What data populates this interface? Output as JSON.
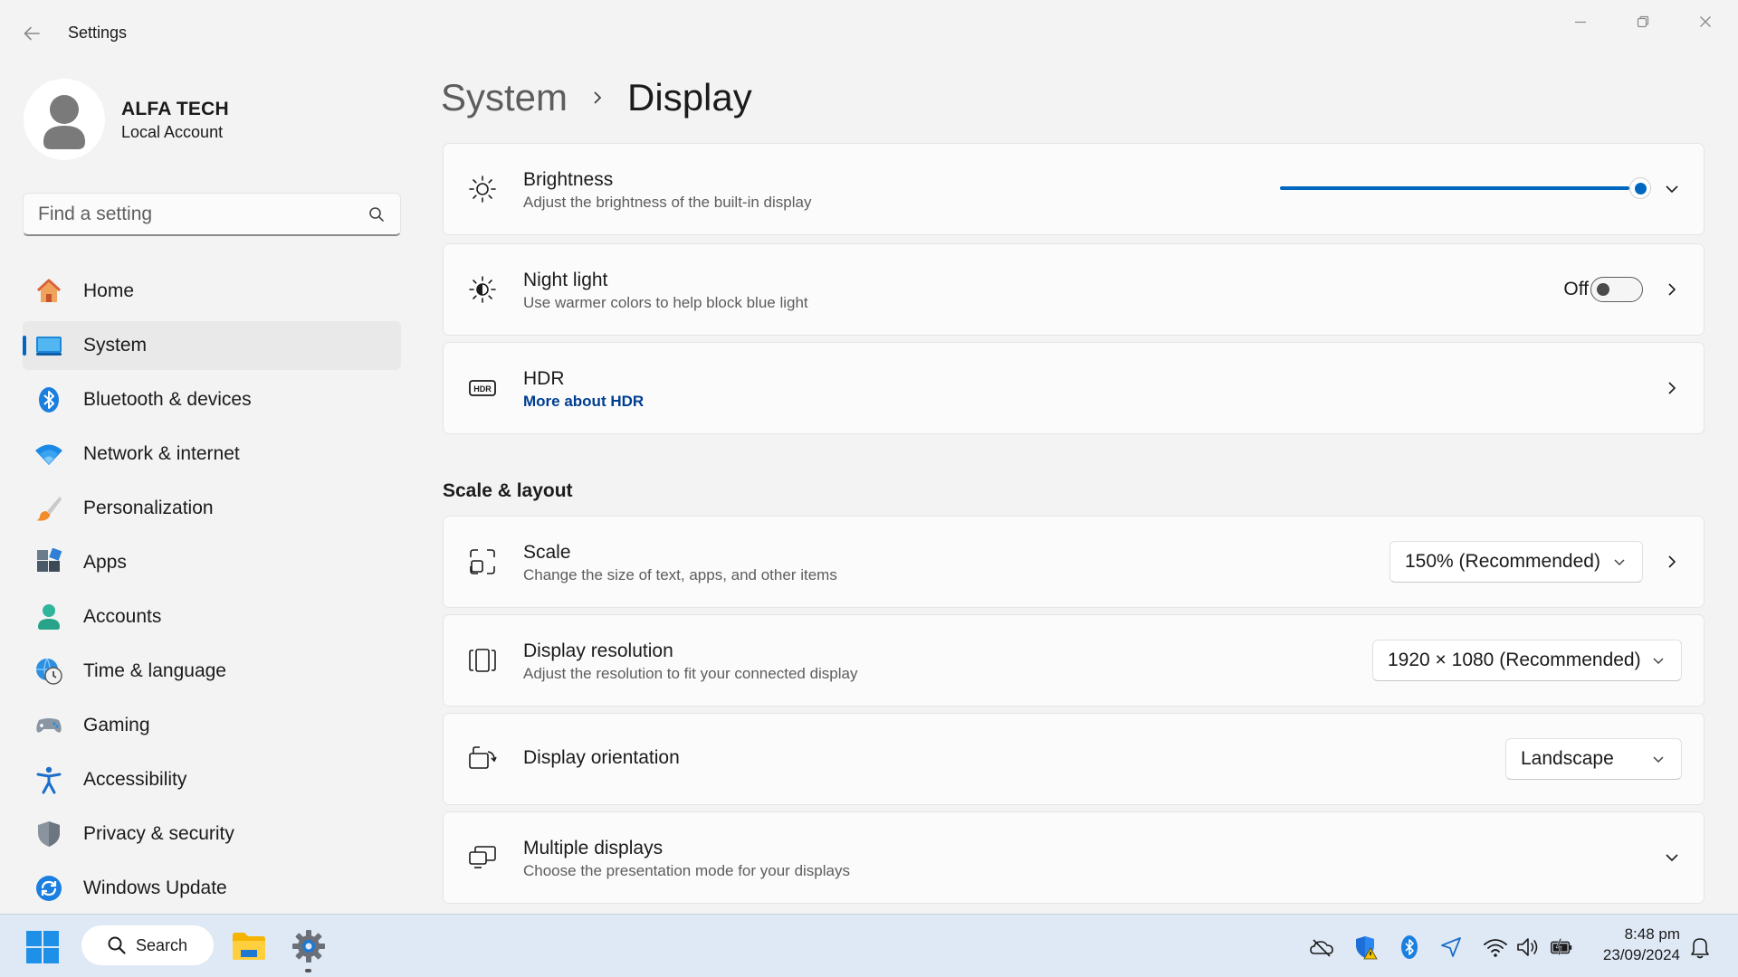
{
  "window": {
    "title": "Settings"
  },
  "user": {
    "name": "ALFA TECH",
    "account_type": "Local Account"
  },
  "search": {
    "placeholder": "Find a setting"
  },
  "sidebar": {
    "items": [
      {
        "label": "Home",
        "icon": "home-icon"
      },
      {
        "label": "System",
        "icon": "system-icon",
        "active": true
      },
      {
        "label": "Bluetooth & devices",
        "icon": "bluetooth-icon"
      },
      {
        "label": "Network & internet",
        "icon": "wifi-icon"
      },
      {
        "label": "Personalization",
        "icon": "brush-icon"
      },
      {
        "label": "Apps",
        "icon": "apps-icon"
      },
      {
        "label": "Accounts",
        "icon": "accounts-icon"
      },
      {
        "label": "Time & language",
        "icon": "globe-clock-icon"
      },
      {
        "label": "Gaming",
        "icon": "gamepad-icon"
      },
      {
        "label": "Accessibility",
        "icon": "accessibility-icon"
      },
      {
        "label": "Privacy & security",
        "icon": "shield-icon"
      },
      {
        "label": "Windows Update",
        "icon": "update-icon"
      }
    ]
  },
  "breadcrumb": {
    "parent": "System",
    "current": "Display"
  },
  "settings": {
    "brightness": {
      "title": "Brightness",
      "subtitle": "Adjust the brightness of the built-in display",
      "level_percent": 100
    },
    "night_light": {
      "title": "Night light",
      "subtitle": "Use warmer colors to help block blue light",
      "state": "Off"
    },
    "hdr": {
      "title": "HDR",
      "link": "More about HDR"
    }
  },
  "scale_layout": {
    "section_title": "Scale & layout",
    "scale": {
      "title": "Scale",
      "subtitle": "Change the size of text, apps, and other items",
      "value": "150% (Recommended)"
    },
    "resolution": {
      "title": "Display resolution",
      "subtitle": "Adjust the resolution to fit your connected display",
      "value": "1920 × 1080 (Recommended)"
    },
    "orientation": {
      "title": "Display orientation",
      "value": "Landscape"
    },
    "multiple": {
      "title": "Multiple displays",
      "subtitle": "Choose the presentation mode for your displays"
    }
  },
  "taskbar": {
    "search_label": "Search",
    "time": "8:48 pm",
    "date": "23/09/2024"
  },
  "colors": {
    "accent": "#0067c0",
    "link": "#003e92",
    "background": "#f3f3f3",
    "card": "#fbfbfb",
    "taskbar": "#dfe9f6"
  }
}
